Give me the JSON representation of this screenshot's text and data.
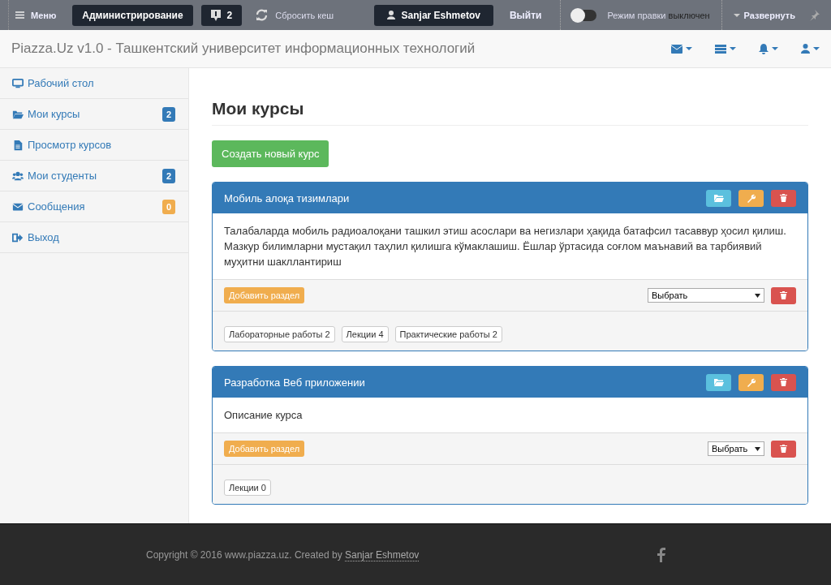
{
  "admin_bar": {
    "menu": "Меню",
    "admin": "Администрирование",
    "notifications": "2",
    "reset_cache": "Сбросить кеш",
    "user": "Sanjar Eshmetov",
    "logout": "Выйти",
    "edit_mode": {
      "label": "Режим правки",
      "state": "выключен",
      "on": false
    },
    "expand": "Развернуть"
  },
  "header": {
    "title": "Piazza.Uz v1.0 - Ташкентский университет информационных технологий"
  },
  "sidebar": {
    "items": [
      {
        "kind": "desktop",
        "label": "Рабочий стол"
      },
      {
        "kind": "folder",
        "label": "Мои курсы",
        "badge": "2",
        "color": "#337ab7"
      },
      {
        "kind": "file",
        "label": "Просмотр курсов"
      },
      {
        "kind": "users",
        "label": "Мои студенты",
        "badge": "2",
        "color": "#337ab7"
      },
      {
        "kind": "mail",
        "label": "Сообщения",
        "badge": "0",
        "color": "#f0ad4e"
      },
      {
        "kind": "exit",
        "label": "Выход"
      }
    ]
  },
  "page": {
    "title": "Мои курсы",
    "create_button": "Создать новый курс"
  },
  "courses": [
    {
      "title": "Мобиль алоқа тизимлари",
      "description": "Талабаларда мобиль радиоалоқани ташкил этиш асослари ва негизлари ҳақида батафсил тасаввур ҳосил қилиш. Мазкур билимларни мустақил таҳлил қилишга кўмаклашиш. Ёшлар ўртасида соғлом маънавий ва тарбиявий муҳитни шакллантириш",
      "add_section": "Добавить раздел",
      "select": "Выбрать",
      "sections": [
        "Лабораторные работы 2",
        "Лекции 4",
        "Практические работы 2"
      ]
    },
    {
      "title": "Разработка Веб приложении",
      "description": "Описание курса",
      "add_section": "Добавить раздел",
      "select": "Выбрать",
      "sections": [
        "Лекции 0"
      ]
    }
  ],
  "footer": {
    "copyright": "Copyright © 2016 www.piazza.uz. Created by ",
    "author_link": "Sanjar Eshmetov"
  }
}
